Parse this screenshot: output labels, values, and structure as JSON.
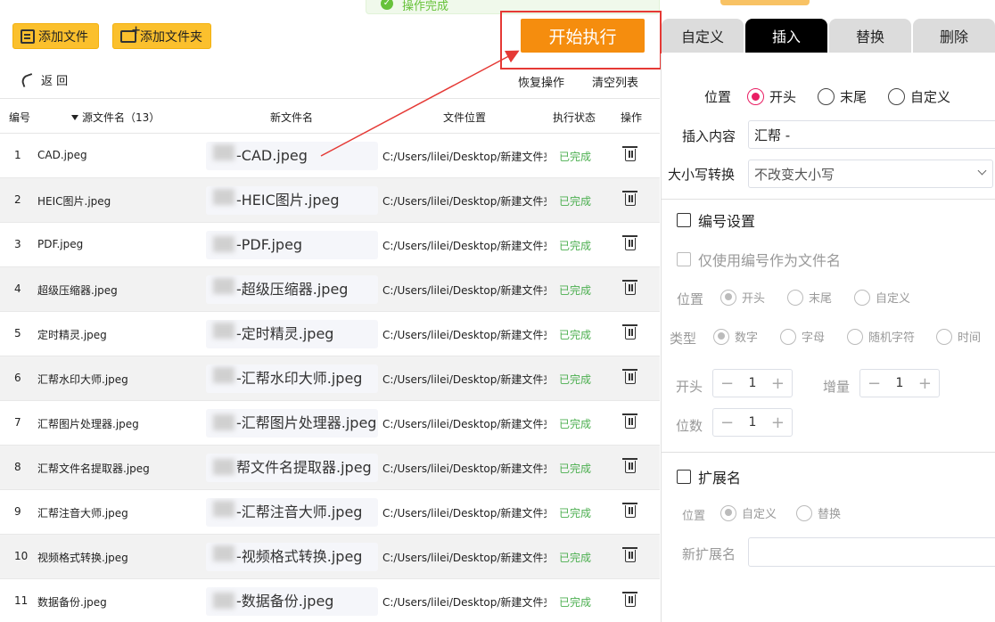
{
  "toast": {
    "text": "操作完成"
  },
  "toolbar": {
    "add_file": "添加文件",
    "add_folder": "添加文件夹",
    "start": "开始执行",
    "back": "返 回",
    "restore": "恢复操作",
    "clear": "清空列表"
  },
  "mode_tabs": [
    {
      "label": "自定义",
      "active": false
    },
    {
      "label": "插入",
      "active": true
    },
    {
      "label": "替换",
      "active": false
    },
    {
      "label": "删除",
      "active": false
    }
  ],
  "table": {
    "headers": {
      "num": "编号",
      "src": "源文件名（13）",
      "newname": "新文件名",
      "path": "文件位置",
      "status": "执行状态",
      "op": "操作"
    },
    "rows": [
      {
        "num": "1",
        "src": "CAD.jpeg",
        "new_hidden": "帮",
        "new": "-CAD.jpeg",
        "path": "C:/Users/lilei/Desktop/新建文件夹",
        "status": "已完成"
      },
      {
        "num": "2",
        "src": "HEIC图片.jpeg",
        "new_hidden": "汇",
        "new": "-HEIC图片.jpeg",
        "path": "C:/Users/lilei/Desktop/新建文件夹",
        "status": "已完成"
      },
      {
        "num": "3",
        "src": "PDF.jpeg",
        "new_hidden": "",
        "new": "-PDF.jpeg",
        "path": "C:/Users/lilei/Desktop/新建文件夹",
        "status": "已完成"
      },
      {
        "num": "4",
        "src": "超级压缩器.jpeg",
        "new_hidden": "汇",
        "new": "-超级压缩器.jpeg",
        "path": "C:/Users/lilei/Desktop/新建文件夹",
        "status": "已完成"
      },
      {
        "num": "5",
        "src": "定时精灵.jpeg",
        "new_hidden": "汇",
        "new": "-定时精灵.jpeg",
        "path": "C:/Users/lilei/Desktop/新建文件夹",
        "status": "已完成"
      },
      {
        "num": "6",
        "src": "汇帮水印大师.jpeg",
        "new_hidden": "帮",
        "new": "-汇帮水印大师.jpeg",
        "path": "C:/Users/lilei/Desktop/新建文件夹",
        "status": "已完成"
      },
      {
        "num": "7",
        "src": "汇帮图片处理器.jpeg",
        "new_hidden": "",
        "new": "-汇帮图片处理器.jpeg",
        "path": "C:/Users/lilei/Desktop/新建文件夹",
        "status": "已完成"
      },
      {
        "num": "8",
        "src": "汇帮文件名提取器.jpeg",
        "new_hidden": "",
        "new": "帮文件名提取器.jpeg",
        "path": "C:/Users/lilei/Desktop/新建文件夹",
        "status": "已完成"
      },
      {
        "num": "9",
        "src": "汇帮注音大师.jpeg",
        "new_hidden": "汇",
        "new": "-汇帮注音大师.jpeg",
        "path": "C:/Users/lilei/Desktop/新建文件夹",
        "status": "已完成"
      },
      {
        "num": "10",
        "src": "视频格式转换.jpeg",
        "new_hidden": "汇",
        "new": "-视频格式转换.jpeg",
        "path": "C:/Users/lilei/Desktop/新建文件夹",
        "status": "已完成"
      },
      {
        "num": "11",
        "src": "数据备份.jpeg",
        "new_hidden": "",
        "new": "-数据备份.jpeg",
        "path": "C:/Users/lilei/Desktop/新建文件夹",
        "status": "已完成"
      }
    ]
  },
  "panel": {
    "position_label": "位置",
    "position_options": [
      "开头",
      "末尾",
      "自定义"
    ],
    "position_selected": "开头",
    "content_label": "插入内容",
    "content_value": "汇帮 -",
    "case_label": "大小写转换",
    "case_value": "不改变大小写",
    "numbering_label": "编号设置",
    "only_number_label": "仅使用编号作为文件名",
    "num_position_label": "位置",
    "num_position_options": [
      "开头",
      "末尾",
      "自定义"
    ],
    "type_label": "类型",
    "type_options": [
      "数字",
      "字母",
      "随机字符",
      "时间"
    ],
    "start_label": "开头",
    "start_value": "1",
    "increment_label": "增量",
    "increment_value": "1",
    "digits_label": "位数",
    "digits_value": "1",
    "ext_label": "扩展名",
    "ext_position_label": "位置",
    "ext_position_options": [
      "自定义",
      "替换"
    ],
    "new_ext_label": "新扩展名",
    "new_ext_value": ""
  },
  "colors": {
    "accent": "#e91e63",
    "start": "#f58d0e",
    "toolbar": "#fbc02d",
    "done": "#4caf50",
    "highlight": "#e53935"
  }
}
